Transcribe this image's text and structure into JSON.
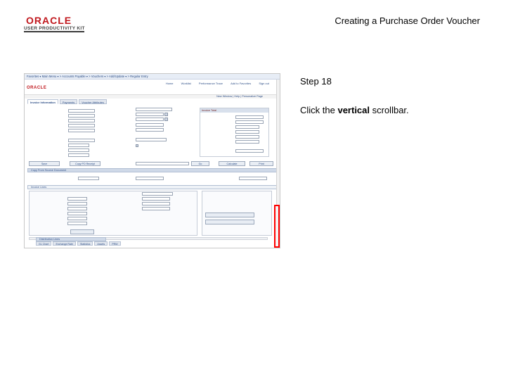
{
  "header": {
    "brand": "ORACLE",
    "product": "USER PRODUCTIVITY KIT",
    "doc_title": "Creating a Purchase Order Voucher"
  },
  "instructions": {
    "step": "Step 18",
    "text_before": "Click the ",
    "text_bold": "vertical",
    "text_after": " scrollbar."
  },
  "app": {
    "logo": "ORACLE",
    "breadcrumb": "Favorites  ▾  Main Menu  ▾  >  Accounts Payable  ▾  >  Vouchers  ▾  >  Add/Update  ▾  >  Regular Entry",
    "header_links": [
      "Home",
      "Worklist",
      "Performance Trace",
      "Add to Favorites",
      "Sign out"
    ],
    "new_window": "New Window | Help | Personalize Page",
    "tabs": [
      "Invoice Information",
      "Payments",
      "Voucher Attributes"
    ],
    "summary_title": "Invoice Total",
    "buttons": [
      "Save",
      "Copy PO Receipt",
      "Go",
      "Calculate",
      "Print"
    ],
    "section_copy_from": "Copy From Source Document",
    "section_invoice_lines": "Invoice Lines",
    "bottom_section": "Distribution Lines",
    "bottom_tabs": [
      "GL Chart",
      "Exchange Rate",
      "Statistics",
      "Assets",
      "PRW"
    ]
  },
  "colors": {
    "oracle_red": "#c0171d",
    "highlight": "#ff0000",
    "link_blue": "#2c4d86"
  }
}
